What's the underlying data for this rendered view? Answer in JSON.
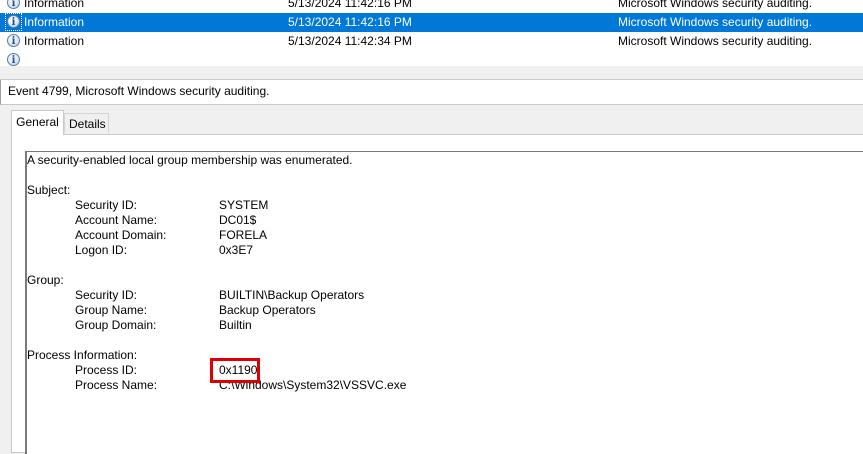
{
  "event_list": {
    "rows": [
      {
        "level": "Information",
        "date": "5/13/2024 11:42:16 PM",
        "source": "Microsoft Windows security auditing.",
        "selected": false
      },
      {
        "level": "Information",
        "date": "5/13/2024 11:42:16 PM",
        "source": "Microsoft Windows security auditing.",
        "selected": true
      },
      {
        "level": "Information",
        "date": "5/13/2024 11:42:34 PM",
        "source": "Microsoft Windows security auditing.",
        "selected": false
      }
    ]
  },
  "detail": {
    "header": "Event 4799, Microsoft Windows security auditing.",
    "tabs": [
      {
        "label": "General",
        "active": true
      },
      {
        "label": "Details",
        "active": false
      }
    ],
    "description": "A security-enabled local group membership was enumerated.",
    "subject": {
      "heading": "Subject:",
      "fields": [
        {
          "label": "Security ID:",
          "value": "SYSTEM"
        },
        {
          "label": "Account Name:",
          "value": "DC01$"
        },
        {
          "label": "Account Domain:",
          "value": "FORELA"
        },
        {
          "label": "Logon ID:",
          "value": "0x3E7"
        }
      ]
    },
    "group": {
      "heading": "Group:",
      "fields": [
        {
          "label": "Security ID:",
          "value": "BUILTIN\\Backup Operators"
        },
        {
          "label": "Group Name:",
          "value": "Backup Operators"
        },
        {
          "label": "Group Domain:",
          "value": "Builtin"
        }
      ]
    },
    "process": {
      "heading": "Process Information:",
      "fields": [
        {
          "label": "Process ID:",
          "value": "0x1190"
        },
        {
          "label": "Process Name:",
          "value": "C:\\Windows\\System32\\VSSVC.exe"
        }
      ]
    }
  },
  "colors": {
    "selection": "#0078d7",
    "highlight_box": "#e00000"
  },
  "icons": {
    "row_icon": "information-icon"
  }
}
